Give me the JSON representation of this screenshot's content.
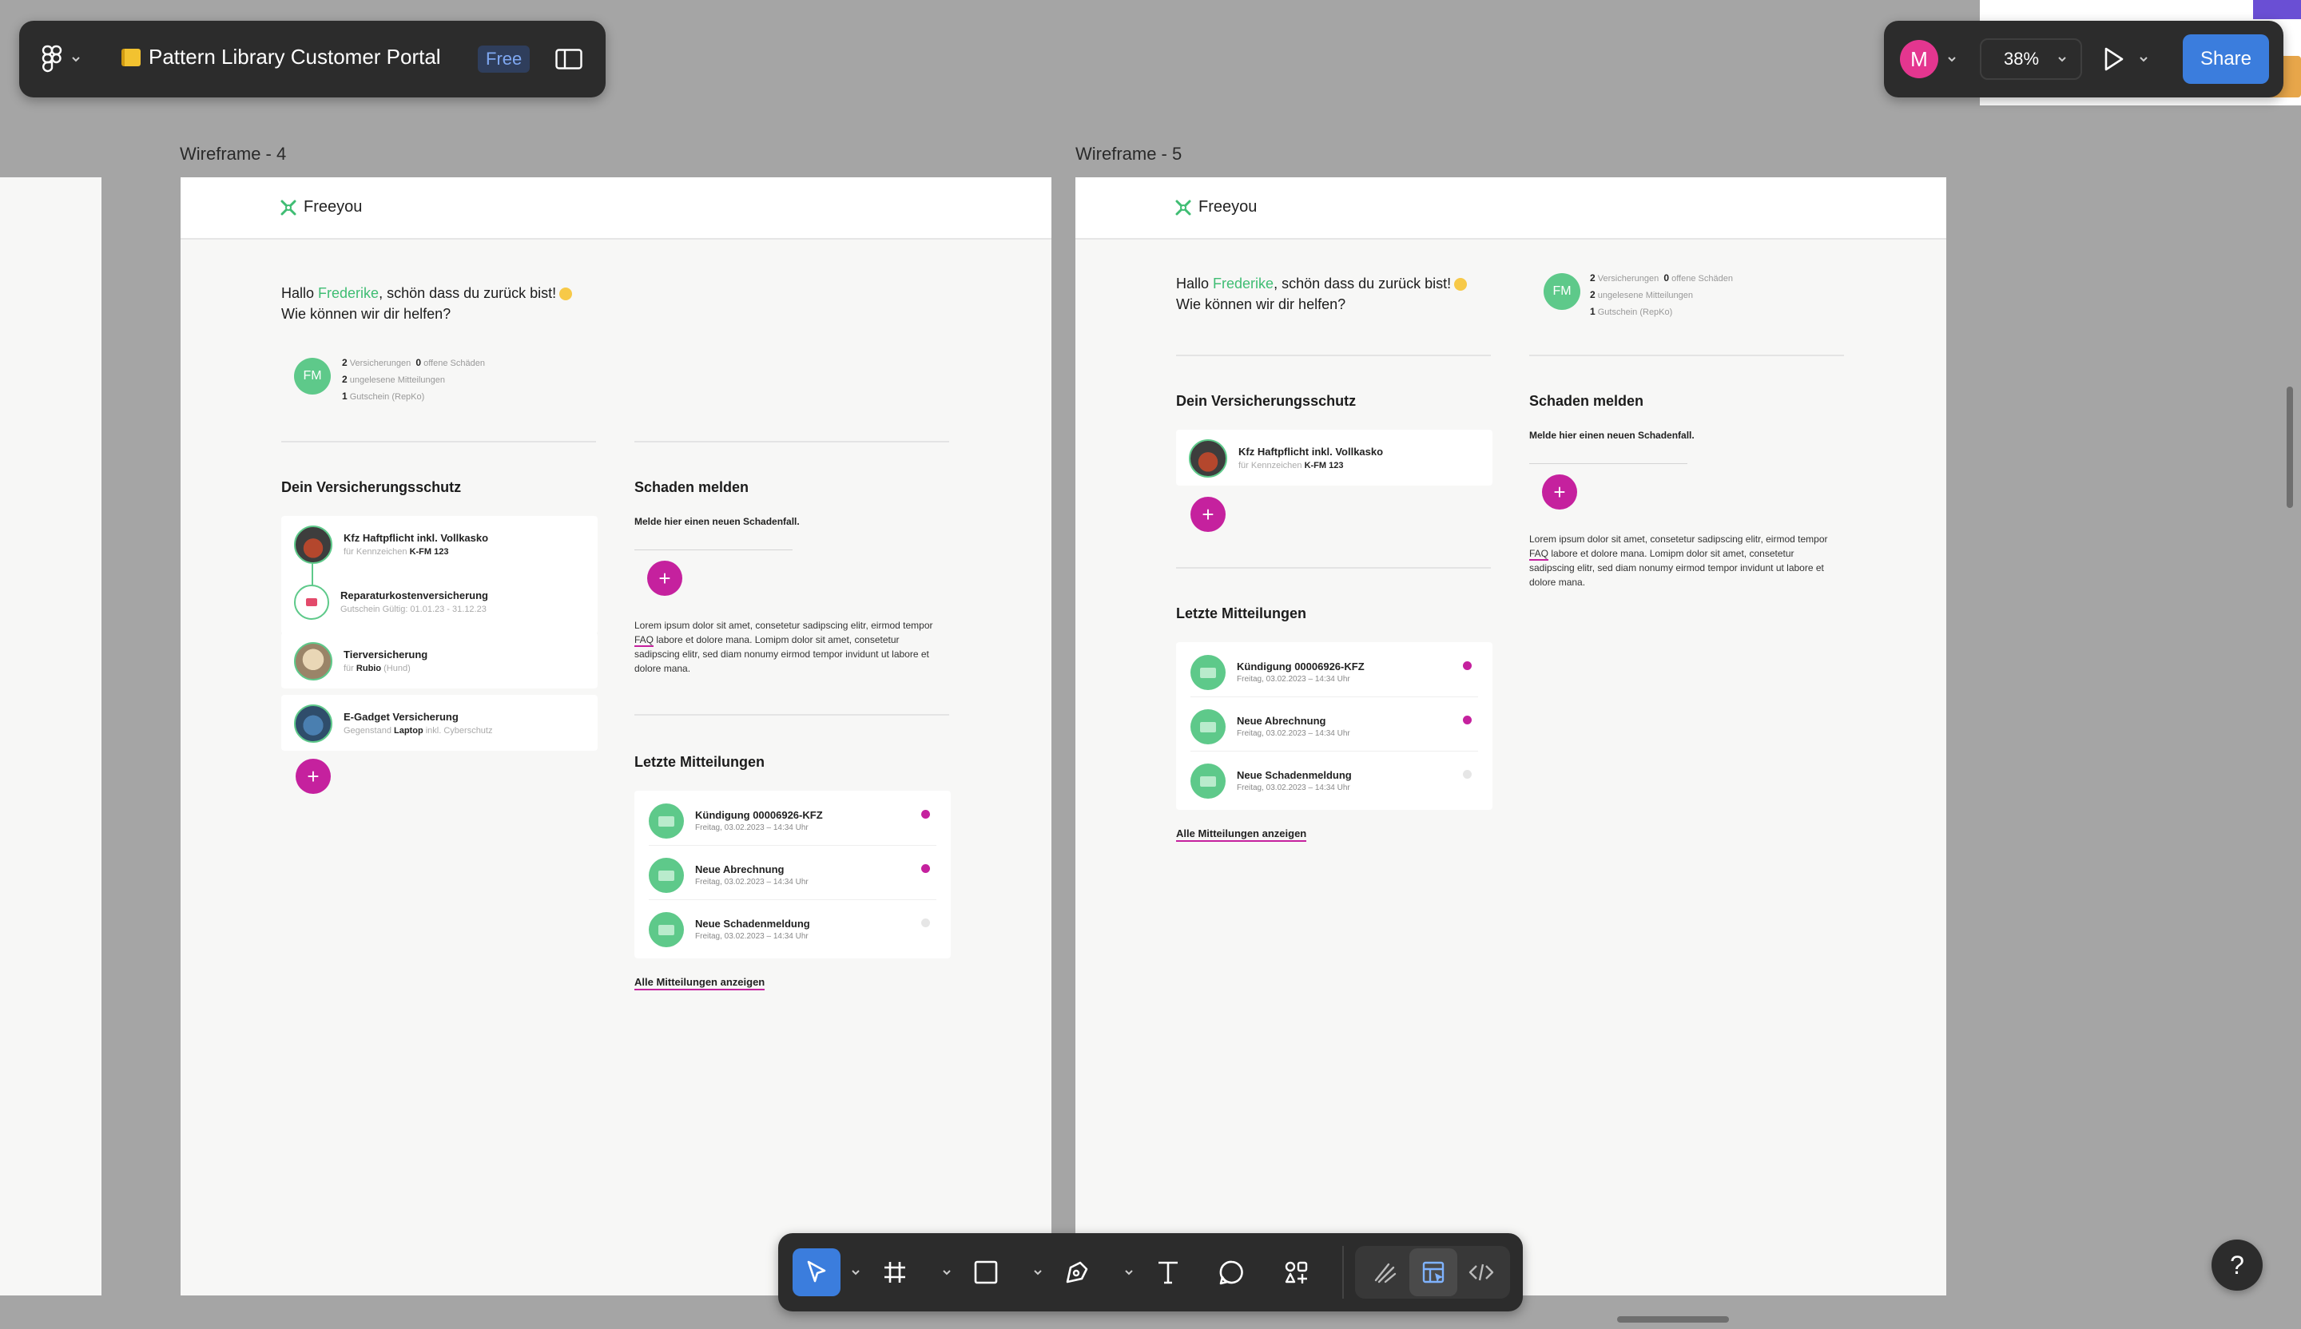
{
  "header": {
    "file_title": "Pattern Library Customer Portal",
    "plan_badge": "Free",
    "user_initial": "M",
    "zoom": "38%",
    "share_label": "Share"
  },
  "help_label": "?",
  "frames": [
    {
      "label": "Wireframe - 4",
      "logo_text": "Freeyou",
      "greeting": {
        "prefix": "Hallo ",
        "name": "Frederike",
        "suffix": ", schön dass du zurück bist!",
        "line2": "Wie können wir dir helfen?"
      },
      "avatar": "FM",
      "stats": [
        {
          "num": "2",
          "text": "Versicherungen",
          "num2": "0",
          "text2": "offene Schäden"
        },
        {
          "num": "2",
          "text": "ungelesene Mitteilungen"
        },
        {
          "num": "1",
          "text": "Gutschein (RepKo)"
        }
      ],
      "insurance": {
        "title": "Dein Versicherungsschutz",
        "items": [
          {
            "title": "Kfz Haftpflicht inkl. Vollkasko",
            "sub_pre": "für Kennzeichen ",
            "sub_bold": "K-FM 123",
            "sub_post": ""
          },
          {
            "title": "Reparaturkostenversicherung",
            "sub_pre": "Gutschein Gültig: 01.01.23 - 31.12.23",
            "sub_bold": "",
            "sub_post": ""
          },
          {
            "title": "Tierversicherung",
            "sub_pre": "für ",
            "sub_bold": "Rubio",
            "sub_post": " (Hund)"
          },
          {
            "title": "E-Gadget Versicherung",
            "sub_pre": "Gegenstand ",
            "sub_bold": "Laptop",
            "sub_post": " inkl. Cyberschutz"
          }
        ]
      },
      "claim": {
        "title": "Schaden melden",
        "subtitle": "Melde hier einen neuen Schadenfall.",
        "lorem_pre": "Lorem ipsum dolor sit amet, consetetur sadipscing elitr, eirmod tempor ",
        "faq": "FAQ",
        "lorem_post": " labore et dolore mana. Lomipm dolor sit amet, consetetur sadipscing elitr, sed diam nonumy eirmod tempor invidunt ut labore et dolore mana."
      },
      "messages": {
        "title": "Letzte Mitteilungen",
        "items": [
          {
            "title": "Kündigung 00006926-KFZ",
            "date": "Freitag, 03.02.2023 – 14:34 Uhr",
            "unread": true
          },
          {
            "title": "Neue Abrechnung",
            "date": "Freitag, 03.02.2023 – 14:34 Uhr",
            "unread": true
          },
          {
            "title": "Neue Schadenmeldung",
            "date": "Freitag, 03.02.2023 – 14:34 Uhr",
            "unread": false
          }
        ],
        "link": "Alle Mitteilungen anzeigen"
      }
    },
    {
      "label": "Wireframe - 5",
      "logo_text": "Freeyou",
      "greeting": {
        "prefix": "Hallo ",
        "name": "Frederike",
        "suffix": ", schön dass du zurück bist!",
        "line2": "Wie können wir dir helfen?"
      },
      "avatar": "FM",
      "stats": [
        {
          "num": "2",
          "text": "Versicherungen",
          "num2": "0",
          "text2": "offene Schäden"
        },
        {
          "num": "2",
          "text": "ungelesene Mitteilungen"
        },
        {
          "num": "1",
          "text": "Gutschein (RepKo)"
        }
      ],
      "insurance": {
        "title": "Dein Versicherungsschutz",
        "items": [
          {
            "title": "Kfz Haftpflicht inkl. Vollkasko",
            "sub_pre": "für Kennzeichen ",
            "sub_bold": "K-FM 123",
            "sub_post": ""
          }
        ]
      },
      "claim": {
        "title": "Schaden melden",
        "subtitle": "Melde hier einen neuen Schadenfall.",
        "lorem_pre": "Lorem ipsum dolor sit amet, consetetur sadipscing elitr, eirmod tempor ",
        "faq": "FAQ",
        "lorem_post": " labore et dolore mana. Lomipm dolor sit amet, consetetur sadipscing elitr, sed diam nonumy eirmod tempor invidunt ut labore et dolore mana."
      },
      "messages": {
        "title": "Letzte Mitteilungen",
        "items": [
          {
            "title": "Kündigung 00006926-KFZ",
            "date": "Freitag, 03.02.2023 – 14:34 Uhr",
            "unread": true
          },
          {
            "title": "Neue Abrechnung",
            "date": "Freitag, 03.02.2023 – 14:34 Uhr",
            "unread": true
          },
          {
            "title": "Neue Schadenmeldung",
            "date": "Freitag, 03.02.2023 – 14:34 Uhr",
            "unread": false
          }
        ],
        "link": "Alle Mitteilungen anzeigen"
      }
    }
  ],
  "colors": {
    "canvas": "#a5a5a5",
    "accent_green": "#3fbd73",
    "accent_magenta": "#c5219e",
    "share_blue": "#3b7ddd",
    "toolbar_bg": "#2c2c2c"
  },
  "icons": {
    "main_menu": "figma-logo-icon",
    "sidebar": "sidebar-toggle-icon",
    "play": "play-icon",
    "move": "move-cursor-icon",
    "frame": "frame-hash-icon",
    "shape": "rectangle-icon",
    "pen": "pen-icon",
    "text": "text-icon",
    "comment": "comment-icon",
    "assets": "assets-icon",
    "draw": "draw-icon",
    "design": "design-mode-icon",
    "dev": "dev-mode-icon",
    "help": "help-icon"
  }
}
